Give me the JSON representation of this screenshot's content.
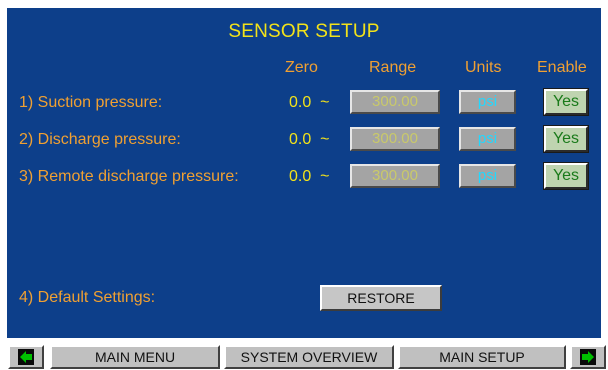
{
  "screen": {
    "title": "SENSOR SETUP"
  },
  "columns": {
    "zero": "Zero",
    "range": "Range",
    "units": "Units",
    "enable": "Enable"
  },
  "separator": "~",
  "sensors": [
    {
      "label": "1) Suction pressure:",
      "zero": "0.0",
      "range": "300.00",
      "units": "psi",
      "enable": "Yes"
    },
    {
      "label": "2) Discharge pressure:",
      "zero": "0.0",
      "range": "300.00",
      "units": "psi",
      "enable": "Yes"
    },
    {
      "label": "3) Remote discharge pressure:",
      "zero": "0.0",
      "range": "300.00",
      "units": "psi",
      "enable": "Yes"
    }
  ],
  "defaults": {
    "label": "4) Default Settings:",
    "button": "RESTORE"
  },
  "nav": {
    "main_menu": "MAIN MENU",
    "system_overview": "SYSTEM OVERVIEW",
    "main_setup": "MAIN SETUP",
    "prev_icon": "arrow-left-icon",
    "next_icon": "arrow-right-icon"
  },
  "colors": {
    "panel_bg": "#0d3f8a",
    "title": "#f2e21a",
    "label": "#f0a032",
    "units_text": "#22d8ff",
    "enable_text": "#1a7a1a",
    "arrow": "#00c000"
  }
}
